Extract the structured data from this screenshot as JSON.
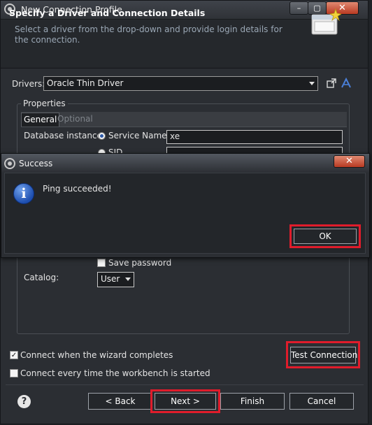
{
  "window": {
    "title": "New Connection Profile",
    "controls": {
      "minimize": "–",
      "maximize": "▢",
      "close": "✕"
    }
  },
  "banner": {
    "title": "Specify a Driver and Connection Details",
    "description": "Select a driver from the drop-down and provide login details for the connection."
  },
  "drivers": {
    "label": "Drivers:",
    "selected": "Oracle Thin Driver"
  },
  "properties": {
    "group_label": "Properties",
    "tabs": [
      {
        "label": "General",
        "active": true
      },
      {
        "label": "Optional",
        "active": false
      }
    ],
    "database_instance_label": "Database instance:",
    "service_name_label": "Service Name",
    "service_name_value": "xe",
    "sid_label": "SID",
    "save_password_label": "Save password",
    "save_password_checked": false,
    "catalog_label": "Catalog:",
    "catalog_value": "User"
  },
  "options": {
    "connect_on_complete_label": "Connect when the wizard completes",
    "connect_on_complete_checked": true,
    "connect_every_startup_label": "Connect every time the workbench is started",
    "connect_every_startup_checked": false
  },
  "buttons": {
    "test_connection": "Test Connection",
    "back": "< Back",
    "next": "Next >",
    "finish": "Finish",
    "cancel": "Cancel",
    "help": "?"
  },
  "dialog": {
    "title": "Success",
    "message": "Ping succeeded!",
    "ok": "OK",
    "close": "✕",
    "icon": "info-icon"
  },
  "colors": {
    "highlight_box": "#e01c2b",
    "accent_blue": "#2e5aa8"
  }
}
